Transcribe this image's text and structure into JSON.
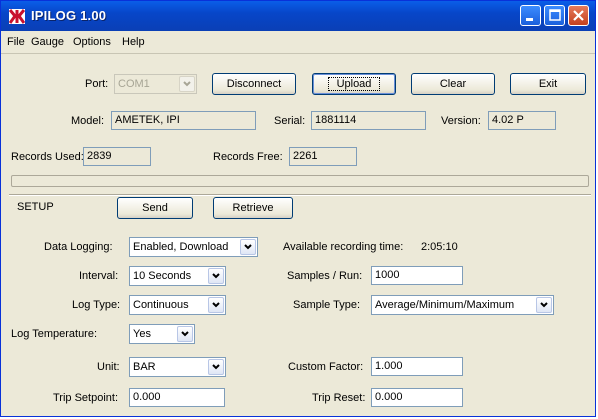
{
  "window": {
    "title": "IPILOG 1.00"
  },
  "menu": [
    "File",
    "Gauge",
    "Options",
    "Help"
  ],
  "connection": {
    "port_label": "Port:",
    "port_value": "COM1",
    "buttons": {
      "disconnect": "Disconnect",
      "upload": "Upload",
      "clear": "Clear",
      "exit": "Exit"
    }
  },
  "device": {
    "model_label": "Model:",
    "model_value": "AMETEK, IPI",
    "serial_label": "Serial:",
    "serial_value": "1881114",
    "version_label": "Version:",
    "version_value": "4.02 P",
    "records_used_label": "Records Used:",
    "records_used_value": "2839",
    "records_free_label": "Records Free:",
    "records_free_value": "2261"
  },
  "progress": {
    "fraction": 0.0
  },
  "setup": {
    "heading": "SETUP",
    "send_label": "Send",
    "retrieve_label": "Retrieve",
    "data_logging_label": "Data Logging:",
    "data_logging_value": "Enabled, Download",
    "available_time_label": "Available recording time:",
    "available_time_value": "2:05:10",
    "interval_label": "Interval:",
    "interval_value": "10 Seconds",
    "samples_label": "Samples / Run:",
    "samples_value": "1000",
    "log_type_label": "Log Type:",
    "log_type_value": "Continuous",
    "sample_type_label": "Sample Type:",
    "sample_type_value": "Average/Minimum/Maximum",
    "log_temp_label": "Log Temperature:",
    "log_temp_value": "Yes",
    "unit_label": "Unit:",
    "unit_value": "BAR",
    "custom_factor_label": "Custom Factor:",
    "custom_factor_value": "1.000",
    "trip_setpoint_label": "Trip Setpoint:",
    "trip_setpoint_value": "0.000",
    "trip_reset_label": "Trip Reset:",
    "trip_reset_value": "0.000"
  },
  "colors": {
    "title_bar": "#0a4fd6",
    "window_bg": "#ece9d8",
    "close_button": "#d5532f"
  }
}
